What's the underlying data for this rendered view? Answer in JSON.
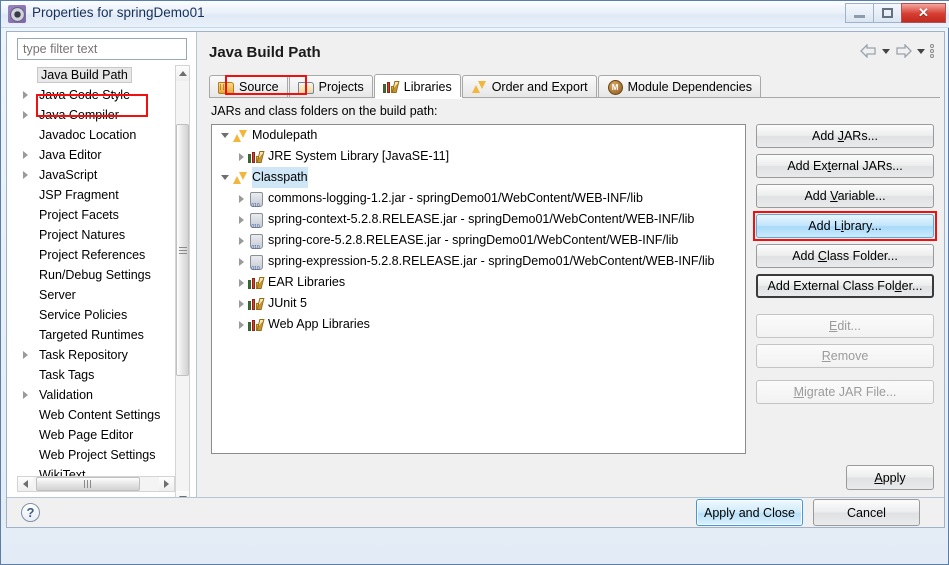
{
  "window": {
    "title": "Properties for springDemo01",
    "icon": "properties-gear-icon",
    "minimize_label": "",
    "maximize_label": "",
    "close_label": "✕"
  },
  "sidebar": {
    "filter": {
      "value": "",
      "placeholder": "type filter text"
    },
    "items": [
      {
        "label": "Java Build Path",
        "expandable": false,
        "selected": true
      },
      {
        "label": "Java Code Style",
        "expandable": true,
        "selected": false
      },
      {
        "label": "Java Compiler",
        "expandable": true,
        "selected": false
      },
      {
        "label": "Javadoc Location",
        "expandable": false,
        "selected": false
      },
      {
        "label": "Java Editor",
        "expandable": true,
        "selected": false
      },
      {
        "label": "JavaScript",
        "expandable": true,
        "selected": false
      },
      {
        "label": "JSP Fragment",
        "expandable": false,
        "selected": false
      },
      {
        "label": "Project Facets",
        "expandable": false,
        "selected": false
      },
      {
        "label": "Project Natures",
        "expandable": false,
        "selected": false
      },
      {
        "label": "Project References",
        "expandable": false,
        "selected": false
      },
      {
        "label": "Run/Debug Settings",
        "expandable": false,
        "selected": false
      },
      {
        "label": "Server",
        "expandable": false,
        "selected": false
      },
      {
        "label": "Service Policies",
        "expandable": false,
        "selected": false
      },
      {
        "label": "Targeted Runtimes",
        "expandable": false,
        "selected": false
      },
      {
        "label": "Task Repository",
        "expandable": true,
        "selected": false
      },
      {
        "label": "Task Tags",
        "expandable": false,
        "selected": false
      },
      {
        "label": "Validation",
        "expandable": true,
        "selected": false
      },
      {
        "label": "Web Content Settings",
        "expandable": false,
        "selected": false
      },
      {
        "label": "Web Page Editor",
        "expandable": false,
        "selected": false
      },
      {
        "label": "Web Project Settings",
        "expandable": false,
        "selected": false
      },
      {
        "label": "WikiText",
        "expandable": false,
        "selected": false
      }
    ]
  },
  "main": {
    "page_title": "Java Build Path",
    "tabs": [
      {
        "label": "Source",
        "icon": "source-folder-icon",
        "active": false
      },
      {
        "label": "Projects",
        "icon": "projects-folder-icon",
        "active": false
      },
      {
        "label": "Libraries",
        "icon": "libraries-books-icon",
        "active": true
      },
      {
        "label": "Order and Export",
        "icon": "order-export-arrows-icon",
        "active": false
      },
      {
        "label": "Module Dependencies",
        "icon": "module-dependencies-icon",
        "active": false
      }
    ],
    "group_label": "JARs and class folders on the build path:",
    "tree": [
      {
        "label": "Modulepath",
        "icon": "order-export-arrows-icon",
        "indent": 0,
        "expander": "open",
        "highlighted": false
      },
      {
        "label": "JRE System Library [JavaSE-11]",
        "icon": "libraries-books-icon",
        "indent": 1,
        "expander": "closed",
        "highlighted": false
      },
      {
        "label": "Classpath",
        "icon": "order-export-arrows-icon",
        "indent": 0,
        "expander": "open",
        "highlighted": true
      },
      {
        "label": "commons-logging-1.2.jar - springDemo01/WebContent/WEB-INF/lib",
        "icon": "jar-icon",
        "indent": 1,
        "expander": "closed",
        "highlighted": false
      },
      {
        "label": "spring-context-5.2.8.RELEASE.jar - springDemo01/WebContent/WEB-INF/lib",
        "icon": "jar-icon",
        "indent": 1,
        "expander": "closed",
        "highlighted": false
      },
      {
        "label": "spring-core-5.2.8.RELEASE.jar - springDemo01/WebContent/WEB-INF/lib",
        "icon": "jar-icon",
        "indent": 1,
        "expander": "closed",
        "highlighted": false
      },
      {
        "label": "spring-expression-5.2.8.RELEASE.jar - springDemo01/WebContent/WEB-INF/lib",
        "icon": "jar-icon",
        "indent": 1,
        "expander": "closed",
        "highlighted": false
      },
      {
        "label": "EAR Libraries",
        "icon": "libraries-books-icon",
        "indent": 1,
        "expander": "closed",
        "highlighted": false
      },
      {
        "label": "JUnit 5",
        "icon": "libraries-books-icon",
        "indent": 1,
        "expander": "closed",
        "highlighted": false
      },
      {
        "label": "Web App Libraries",
        "icon": "libraries-books-icon",
        "indent": 1,
        "expander": "closed",
        "highlighted": false
      }
    ],
    "buttons": [
      {
        "label": "Add JARs...",
        "state": "normal",
        "highlighted": false
      },
      {
        "label": "Add External JARs...",
        "state": "normal",
        "highlighted": false
      },
      {
        "label": "Add Variable...",
        "state": "normal",
        "highlighted": false
      },
      {
        "label": "Add Library...",
        "state": "focused",
        "highlighted": true
      },
      {
        "label": "Add Class Folder...",
        "state": "normal",
        "highlighted": false
      },
      {
        "label": "Add External Class Folder...",
        "state": "default",
        "highlighted": false
      },
      {
        "label": "Edit...",
        "state": "disabled",
        "highlighted": false
      },
      {
        "label": "Remove",
        "state": "disabled",
        "highlighted": false
      },
      {
        "label": "Migrate JAR File...",
        "state": "disabled",
        "highlighted": false
      }
    ],
    "apply_label": "Apply",
    "nav": {
      "back_icon": "arrow-left-icon",
      "back_dropdown_icon": "chevron-down-icon",
      "forward_icon": "arrow-right-icon",
      "forward_dropdown_icon": "chevron-down-icon",
      "menu_icon": "vertical-dots-icon"
    }
  },
  "footer": {
    "help_icon": "?",
    "apply_and_close_label": "Apply and Close",
    "cancel_label": "Cancel"
  },
  "colors": {
    "highlight_red": "#f01010",
    "selection_blue": "#cfe6f7",
    "focus_blue": "#a6d9f8"
  }
}
